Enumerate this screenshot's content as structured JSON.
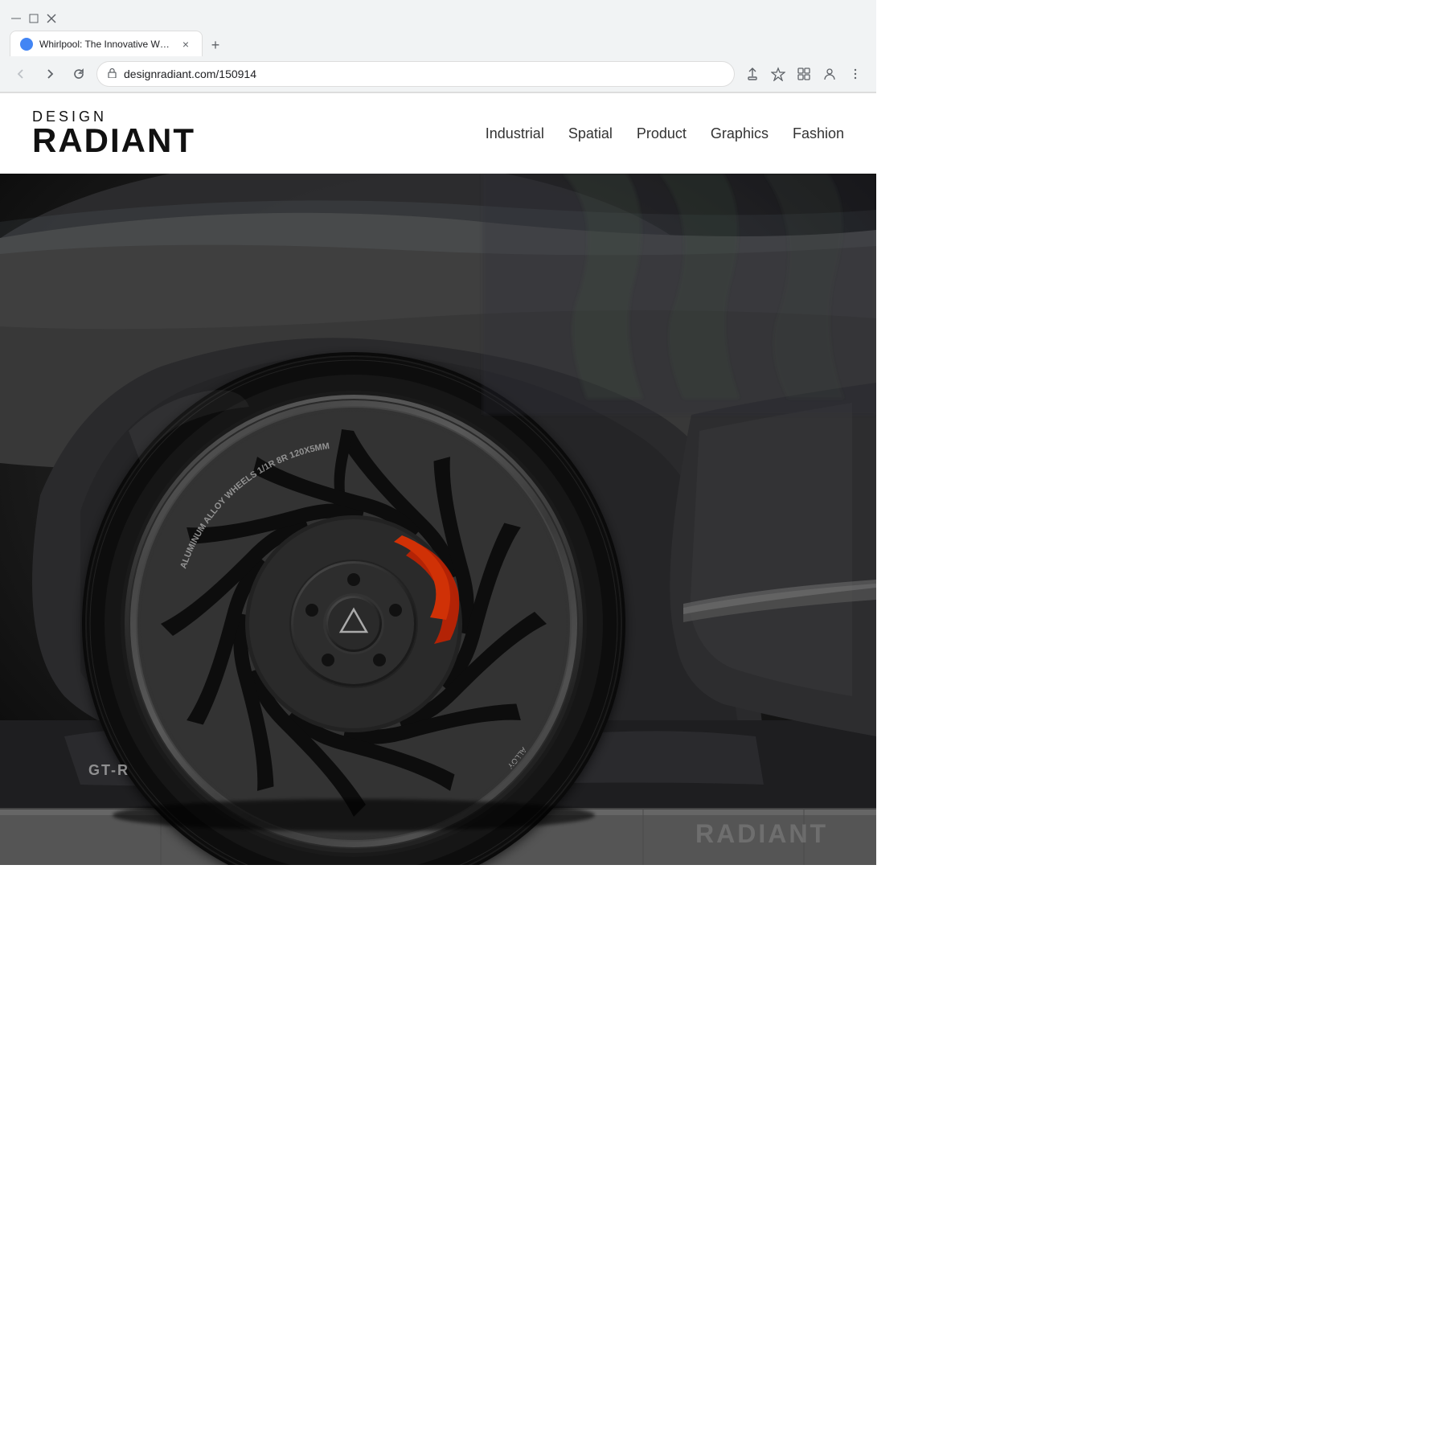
{
  "browser": {
    "tab_title": "Whirlpool: The Innovative Whee",
    "url": "designradiant.com/150914",
    "new_tab_label": "+",
    "back_label": "←",
    "forward_label": "→",
    "reload_label": "↺",
    "lock_icon": "🔒"
  },
  "header": {
    "logo_design": "DESIGN",
    "logo_radiant": "RADIANT",
    "nav_items": [
      {
        "id": "industrial",
        "label": "Industrial"
      },
      {
        "id": "spatial",
        "label": "Spatial"
      },
      {
        "id": "product",
        "label": "Product"
      },
      {
        "id": "graphics",
        "label": "Graphics"
      },
      {
        "id": "fashion",
        "label": "Fashion"
      }
    ]
  },
  "hero": {
    "watermark": "RADIANT",
    "alt": "Whirlpool aluminum alloy wheel close-up on dark sports car"
  }
}
